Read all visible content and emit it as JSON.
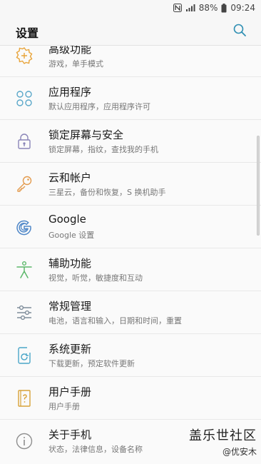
{
  "status_bar": {
    "battery": "88%",
    "time": "09:24"
  },
  "header": {
    "title": "设置"
  },
  "items": [
    {
      "label": "高级功能",
      "sub": "游戏，单手模式",
      "icon": "advanced-features-icon",
      "color": "#e8a43a"
    },
    {
      "label": "应用程序",
      "sub": "默认应用程序，应用程序许可",
      "icon": "apps-icon",
      "color": "#5aa7c9"
    },
    {
      "label": "锁定屏幕与安全",
      "sub": "锁定屏幕，指纹，查找我的手机",
      "icon": "lock-icon",
      "color": "#8a85b8"
    },
    {
      "label": "云和帐户",
      "sub": "三星云，备份和恢复，S 换机助手",
      "icon": "key-icon",
      "color": "#e39a4c"
    },
    {
      "label": "Google",
      "sub": "Google 设置",
      "icon": "google-icon",
      "color": "#4f87c8"
    },
    {
      "label": "辅助功能",
      "sub": "视觉，听觉，敏捷度和互动",
      "icon": "accessibility-icon",
      "color": "#5cb86a"
    },
    {
      "label": "常规管理",
      "sub": "电池，语言和输入，日期和时间，重置",
      "icon": "sliders-icon",
      "color": "#7e8c9a"
    },
    {
      "label": "系统更新",
      "sub": "下载更新，预定软件更新",
      "icon": "system-update-icon",
      "color": "#4aa6c8"
    },
    {
      "label": "用户手册",
      "sub": "用户手册",
      "icon": "user-manual-icon",
      "color": "#d7a237"
    },
    {
      "label": "关于手机",
      "sub": "状态，法律信息，设备名称",
      "icon": "info-icon",
      "color": "#8e8e8e"
    }
  ],
  "watermark": {
    "line1": "盖乐世社区",
    "line2": "@优安木"
  }
}
